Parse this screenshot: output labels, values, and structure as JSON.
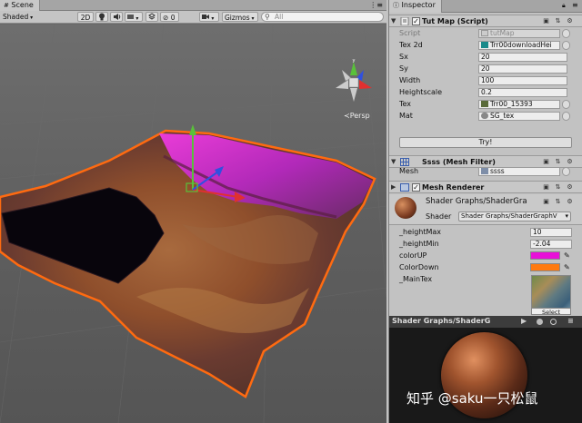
{
  "scene": {
    "tab_label": "Scene",
    "toolbar": {
      "shading_mode": "Shaded",
      "mode_2d": "2D",
      "light_icon": "lightbulb-icon",
      "audio_icon": "speaker-icon",
      "fx_icon": "image-effects-icon",
      "hidden_count": "0",
      "camera_icon": "camera-icon",
      "gizmos_label": "Gizmos",
      "search_placeholder": "All"
    },
    "persp_label": "Persp",
    "gizmo_colors": {
      "x": "#e03030",
      "y": "#59c13a",
      "z": "#3050e0"
    }
  },
  "inspector": {
    "tab_label": "Inspector",
    "tut_map": {
      "title": "Tut Map (Script)",
      "enabled": true,
      "fields": [
        {
          "label": "Script",
          "value": "tutMap",
          "dim": true
        },
        {
          "label": "Tex 2d",
          "value": "Trr00downloadHei"
        },
        {
          "label": "Sx",
          "value": "20"
        },
        {
          "label": "Sy",
          "value": "20"
        },
        {
          "label": "Width",
          "value": "100"
        },
        {
          "label": "Heightscale",
          "value": "0.2"
        },
        {
          "label": "Tex",
          "value": "Trr00_15393"
        },
        {
          "label": "Mat",
          "value": "SG_tex"
        }
      ],
      "button_label": "Try!"
    },
    "mesh_filter": {
      "title": "Ssss (Mesh Filter)",
      "mesh_label": "Mesh",
      "mesh_value": "ssss"
    },
    "mesh_renderer": {
      "title": "Mesh Renderer",
      "enabled": true
    },
    "material": {
      "name": "Shader Graphs/ShaderGra",
      "shader_label": "Shader",
      "shader_value": "Shader Graphs/ShaderGraphV",
      "properties": [
        {
          "label": "_heightMax",
          "value": "10"
        },
        {
          "label": "_heightMin",
          "value": "-2.04"
        }
      ],
      "colors": [
        {
          "label": "colorUP",
          "color": "#e810d8"
        },
        {
          "label": "ColorDown",
          "color": "#ff7a10"
        }
      ],
      "main_tex_label": "_MainTex",
      "select_label": "Select"
    },
    "preview": {
      "title": "Shader Graphs/ShaderG"
    }
  },
  "watermark": "知乎 @saku一只松鼠"
}
